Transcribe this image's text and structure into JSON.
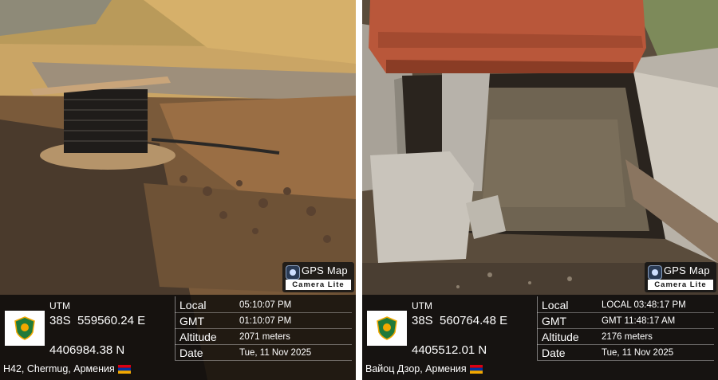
{
  "photos": [
    {
      "badge": {
        "title": "GPS Map",
        "subtitle": "Camera Lite"
      },
      "utm_label": "UTM",
      "utm_zone": "38S",
      "easting": "559560.24 E",
      "northing": "4406984.38 N",
      "rows": [
        {
          "label": "Local",
          "value": "05:10:07 PM"
        },
        {
          "label": "GMT",
          "value": "01:10:07 PM"
        },
        {
          "label": "Altitude",
          "value": "2071 meters"
        },
        {
          "label": "Date",
          "value": "Tue, 11 Nov 2025"
        }
      ],
      "place": "H42, Chermug, Армения"
    },
    {
      "badge": {
        "title": "GPS Map",
        "subtitle": "Camera Lite"
      },
      "utm_label": "UTM",
      "utm_zone": "38S",
      "easting": "560764.48 E",
      "northing": "4405512.01 N",
      "rows": [
        {
          "label": "Local",
          "value": "LOCAL 03:48:17 PM"
        },
        {
          "label": "GMT",
          "value": "GMT 11:48:17 AM"
        },
        {
          "label": "Altitude",
          "value": "2176 meters"
        },
        {
          "label": "Date",
          "value": "Tue, 11 Nov 2025"
        }
      ],
      "place": "Вайоц Дзор, Армения"
    }
  ],
  "icons": {
    "logo": "shield-emblem-icon",
    "camera": "camera-app-icon",
    "flag": "armenia-flag-icon"
  },
  "colors": {
    "overlay": "#080808",
    "flag_red": "#d90012",
    "flag_blue": "#0033a0",
    "flag_orange": "#f2a800",
    "emblem_green": "#1f7a3a"
  }
}
